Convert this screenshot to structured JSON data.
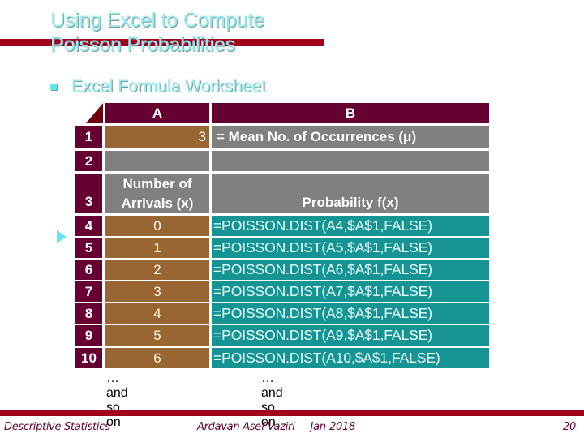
{
  "slide": {
    "title_lines": [
      "Using Excel to Compute",
      "Poisson Probabilities"
    ],
    "bullet": "Excel Formula Worksheet",
    "accent_color": "#a0001e",
    "title_color": "#99ecee"
  },
  "worksheet": {
    "columns": [
      "A",
      "B"
    ],
    "rows": [
      {
        "row": "1",
        "a": "3",
        "b": "= Mean No. of Occurrences (μ)"
      },
      {
        "row": "2",
        "a": "",
        "b": ""
      },
      {
        "row": "3",
        "a_lines": [
          "Number of",
          "Arrivals (x)"
        ],
        "b": "Probability  f(x)"
      },
      {
        "row": "4",
        "a": "0",
        "b": "=POISSON.DIST(A4,$A$1,FALSE)"
      },
      {
        "row": "5",
        "a": "1",
        "b": "=POISSON.DIST(A5,$A$1,FALSE)"
      },
      {
        "row": "6",
        "a": "2",
        "b": "=POISSON.DIST(A6,$A$1,FALSE)"
      },
      {
        "row": "7",
        "a": "3",
        "b": "=POISSON.DIST(A7,$A$1,FALSE)"
      },
      {
        "row": "8",
        "a": "4",
        "b": "=POISSON.DIST(A8,$A$1,FALSE)"
      },
      {
        "row": "9",
        "a": "5",
        "b": "=POISSON.DIST(A9,$A$1,FALSE)"
      },
      {
        "row": "10",
        "a": "6",
        "b": "=POISSON.DIST(A10,$A$1,FALSE)"
      }
    ],
    "continuation_a": "… and so on",
    "continuation_b": "… and so on",
    "colors": {
      "header": "#660033",
      "input_cell": "#996633",
      "label_cell": "#808080",
      "formula_cell": "#169494"
    }
  },
  "footer": {
    "left": "Descriptive Statistics",
    "center": "Ardavan Asef-Vaziri     Jan-2018",
    "page_number": "20"
  }
}
